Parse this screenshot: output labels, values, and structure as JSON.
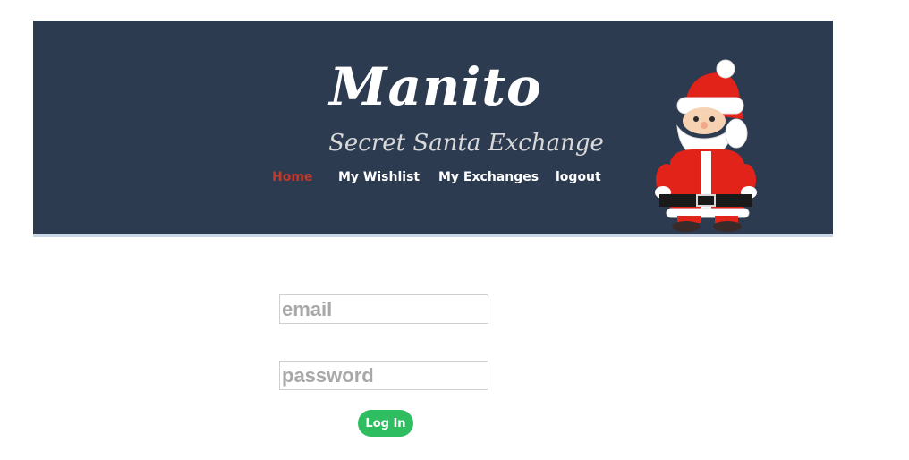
{
  "header": {
    "title": "Manito",
    "subtitle": "Secret Santa Exchange",
    "background": "#2d3b50",
    "mascot_icon": "santa-claus-icon"
  },
  "nav": {
    "items": [
      {
        "label": "Home",
        "active": true
      },
      {
        "label": "My Wishlist",
        "active": false
      },
      {
        "label": "My Exchanges",
        "active": false
      },
      {
        "label": "logout",
        "active": false
      }
    ],
    "active_color": "#c0392b"
  },
  "login": {
    "email_placeholder": "email",
    "email_value": "",
    "password_placeholder": "password",
    "password_value": "",
    "submit_label": "Log In",
    "submit_color": "#2ebd60"
  }
}
